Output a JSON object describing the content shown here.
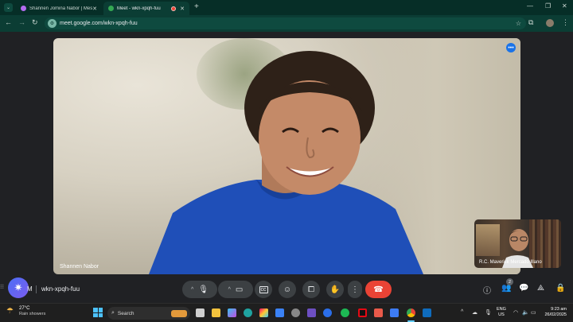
{
  "browser": {
    "tabs": [
      {
        "title": "Shannen Jomina Nabor | Messe",
        "active": false,
        "favicon_color": "#b36cf0"
      },
      {
        "title": "Meet - wkn-xpqh-fuu",
        "active": true,
        "favicon_color": "#34a853"
      }
    ],
    "new_tab_symbol": "+",
    "url": "meet.google.com/wkn-xpqh-fuu"
  },
  "meet": {
    "main_participant_name": "Shannen Nabor",
    "self_name": "R.C. Maverick Mercado Illano",
    "meeting_code": "wkn-xpqh-fuu",
    "time_fragment": "M",
    "people_count": "2",
    "more_options_symbol": "•••",
    "end_call_color": "#ea4335"
  },
  "taskbar": {
    "weather_temp": "27°C",
    "weather_desc": "Rain showers",
    "search_label": "Search",
    "lang_line1": "ENG",
    "lang_line2": "US",
    "time": "9:23 am",
    "date": "26/02/2025"
  },
  "colors": {
    "tabstrip": "#062e27",
    "toolbar": "#0b3d34",
    "meet_bg": "#202124",
    "accent_blue": "#1a73e8"
  }
}
